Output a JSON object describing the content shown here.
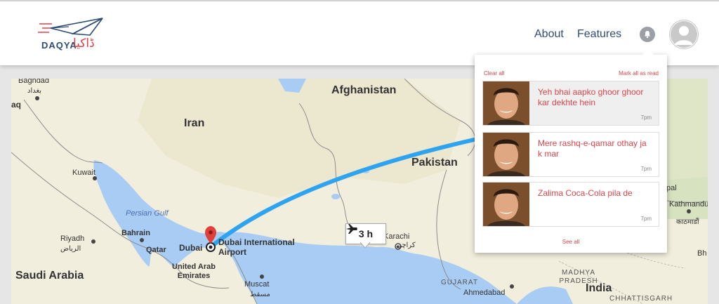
{
  "header": {
    "logo_text": "DAQYA",
    "logo_urdu": "ڈاکیا",
    "nav": [
      "About",
      "Features"
    ],
    "bell_icon": "bell-icon",
    "avatar_icon": "user-avatar-icon"
  },
  "map": {
    "countries": [
      "Afghanistan",
      "Iran",
      "Pakistan",
      "Saudi Arabia",
      "India"
    ],
    "cities": {
      "baghdad": "Baghdad",
      "baghdad_ar": "بغداد",
      "iraq_partial": "aq",
      "kuwait": "Kuwait",
      "bahrain": "Bahrain",
      "riyadh": "Riyadh",
      "riyadh_ar": "الرياض",
      "qatar": "Qatar",
      "dubai": "Dubai",
      "airport": "Dubai International Airport",
      "uae": "United Arab Emirates",
      "muscat": "Muscat",
      "muscat_ar": "مسقط",
      "karachi": "Karachi",
      "karachi_ur": "کراچی",
      "kathmandu": "Kathmandu",
      "kathmandu_ne": "काठमाडौं",
      "ahmedabad": "Ahmedabad",
      "nepal_partial": "pal",
      "chennai_partial": "CHHATTISGARH",
      "bhopal_partial": "Bh"
    },
    "water": "Persian Gulf",
    "regions": [
      "GUJARAT",
      "MADHYA PRADESH",
      "CHHATTISGARH"
    ],
    "flight_duration": "3 h",
    "plane_icon": "plane-icon"
  },
  "notifications": {
    "clear_all": "Clear all",
    "mark_all": "Mark all as read",
    "see_all": "See all",
    "items": [
      {
        "text": "Yeh bhai aapko ghoor ghoor kar dekhte hein",
        "time": "7pm"
      },
      {
        "text": "Mere rashq-e-qamar othay ja k mar",
        "time": "7pm"
      },
      {
        "text": "Zalima Coca-Cola pila de",
        "time": "7pm"
      }
    ]
  },
  "colors": {
    "brand_blue": "#2f4d72",
    "brand_red": "#e0424b",
    "flight_path": "#2ea4f0",
    "sea": "#a9ccf5",
    "land": "#f3eedd"
  }
}
